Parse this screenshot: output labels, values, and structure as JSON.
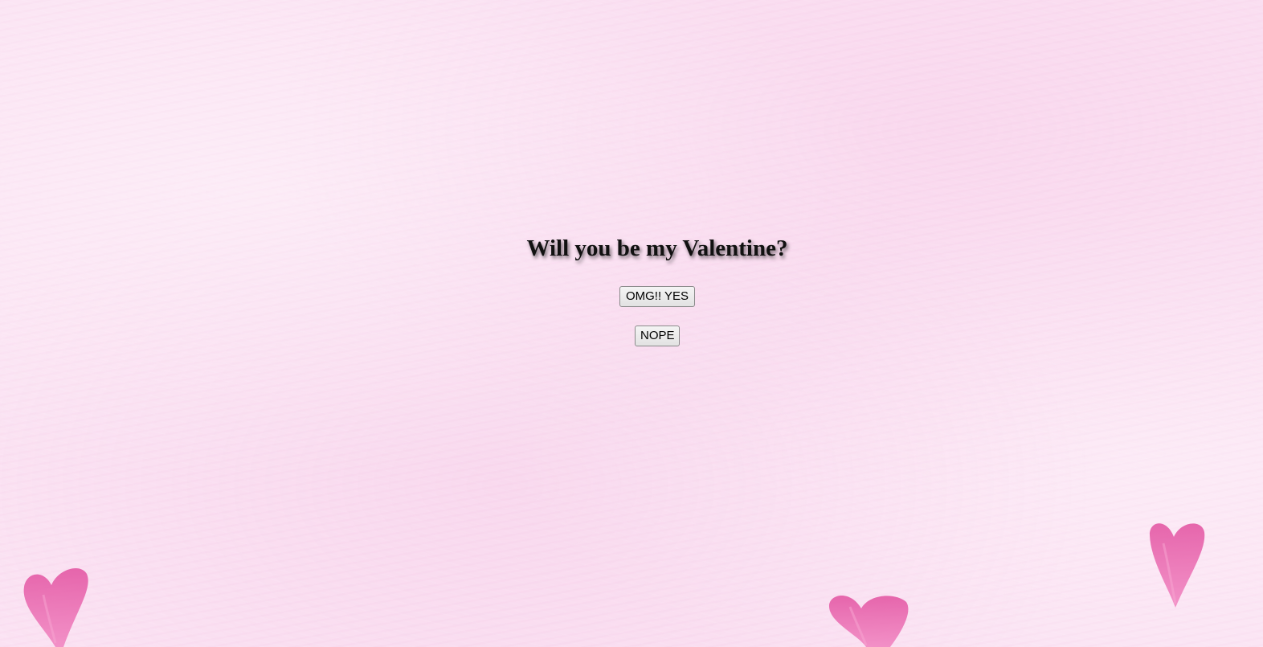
{
  "page": {
    "question": "Will you be my Valentine?",
    "yes_button": "OMG!! YES",
    "no_button": "NOPE"
  },
  "decorations": [
    {
      "name": "heart-icon",
      "color": "#e85aa8"
    },
    {
      "name": "heart-icon",
      "color": "#e85aa8"
    },
    {
      "name": "heart-icon",
      "color": "#e85aa8"
    }
  ],
  "colors": {
    "background": "#fbe3f3",
    "heart": "#e85aa8",
    "text": "#111111"
  }
}
